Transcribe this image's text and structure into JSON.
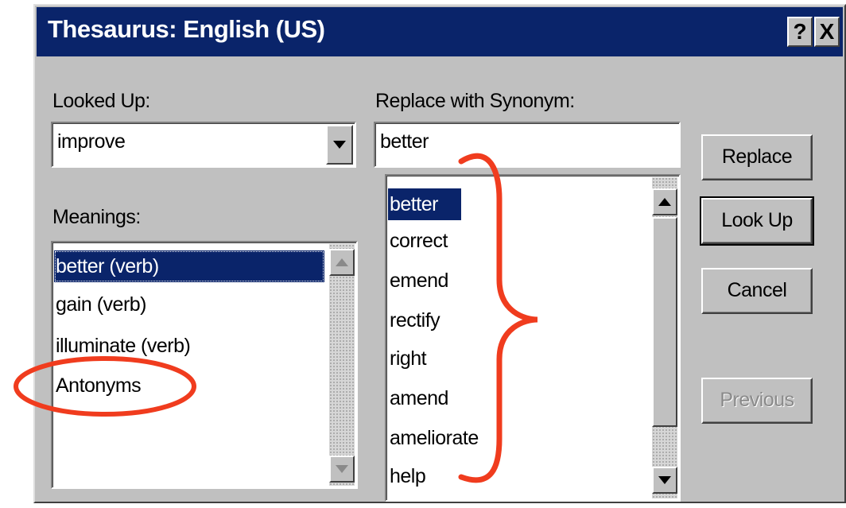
{
  "window": {
    "title": "Thesaurus: English (US)",
    "help_button": "?",
    "close_button": "X"
  },
  "looked_up": {
    "label": "Looked Up:",
    "value": "improve"
  },
  "meanings": {
    "label": "Meanings:",
    "items": [
      "better (verb)",
      "gain (verb)",
      "illuminate (verb)",
      "Antonyms"
    ],
    "selected_index": 0
  },
  "synonym": {
    "label": "Replace with Synonym:",
    "value": "better",
    "items": [
      "better",
      "correct",
      "emend",
      "rectify",
      "right",
      "amend",
      "ameliorate",
      "help"
    ],
    "selected_index": 0
  },
  "buttons": {
    "replace": "Replace",
    "look_up": "Look Up",
    "cancel": "Cancel",
    "previous": "Previous"
  },
  "colors": {
    "title_bar": "#0a246a",
    "face": "#c0c0c0",
    "selection": "#0a246a",
    "annotation": "#f03c1e"
  }
}
